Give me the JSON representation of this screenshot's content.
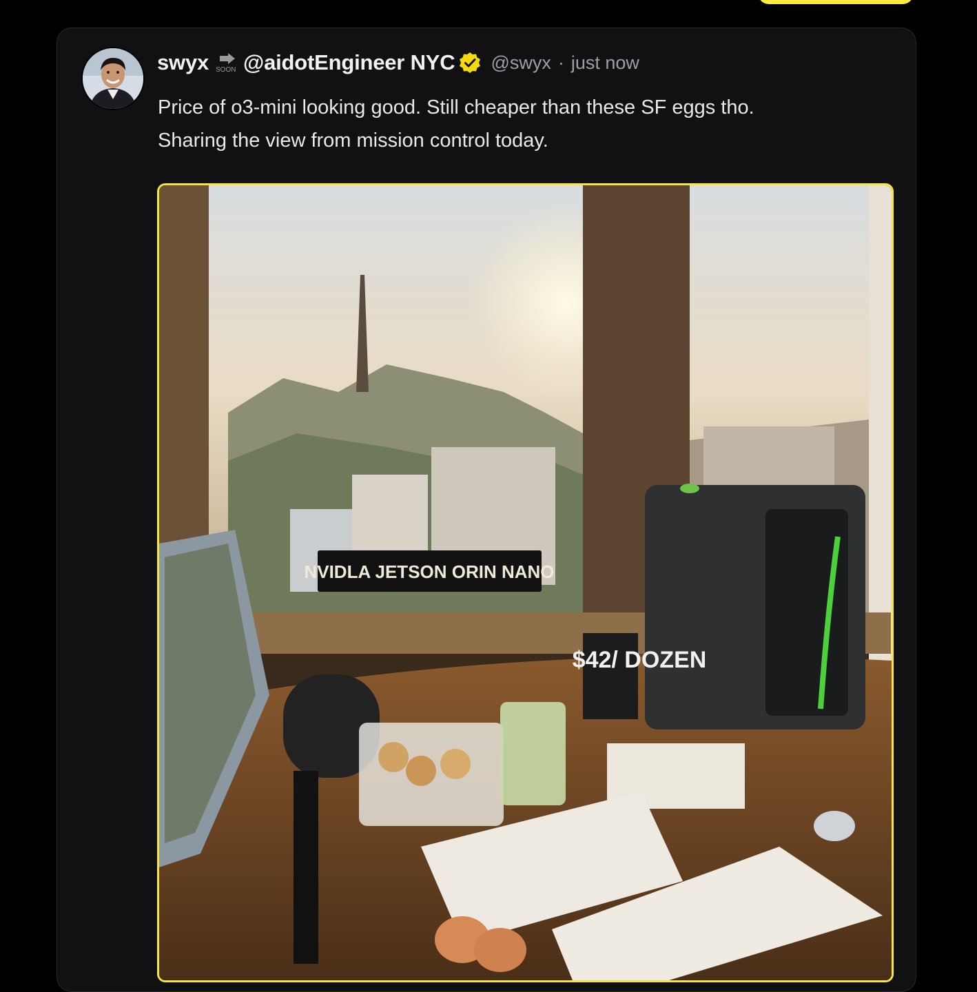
{
  "tweet": {
    "display_name": "swyx",
    "soon_label": "SOON",
    "display_name_suffix": "@aidotEngineer NYC",
    "handle": "@swyx",
    "separator": "·",
    "timestamp": "just now",
    "text_lines": [
      "Price of o3-mini looking good. Still cheaper than these SF eggs tho.",
      "Sharing the view from mission control today."
    ]
  },
  "image": {
    "sign_text": "NVIDLA JETSON ORIN NANO",
    "price_card_text": "$42/ DOZEN"
  },
  "colors": {
    "accent": "#f5e642",
    "background": "#000000",
    "card": "#111113",
    "muted_text": "#9aa0a6",
    "verified_badge": "#f5d90a"
  },
  "icons": [
    "soon-arrow-icon",
    "verified-badge-icon"
  ]
}
